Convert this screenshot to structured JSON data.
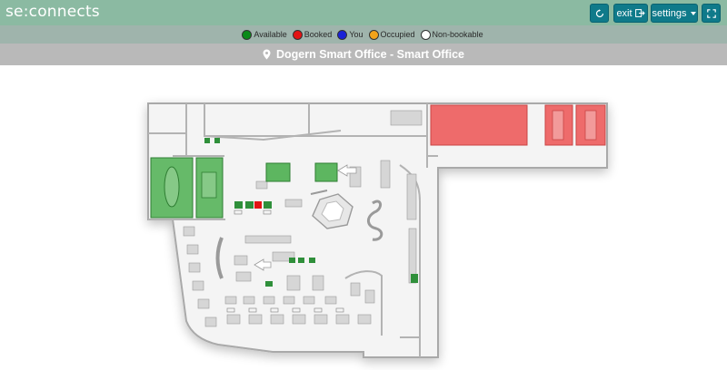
{
  "app": {
    "brand": "se:connects"
  },
  "toolbar": {
    "exit_label": "exit",
    "settings_label": "settings"
  },
  "legend": {
    "items": [
      {
        "label": "Available",
        "color": "#0a8a18"
      },
      {
        "label": "Booked",
        "color": "#e31414"
      },
      {
        "label": "You",
        "color": "#1a22d6"
      },
      {
        "label": "Occupied",
        "color": "#f2a31a"
      },
      {
        "label": "Non-bookable",
        "color": "#ffffff"
      }
    ]
  },
  "location": {
    "title": "Dogern Smart Office - Smart Office"
  },
  "colors": {
    "topbar": "#8bbaa2",
    "button": "#0f7a8a",
    "available_zone": "#4caf50",
    "booked_zone": "#ee6b6b"
  }
}
